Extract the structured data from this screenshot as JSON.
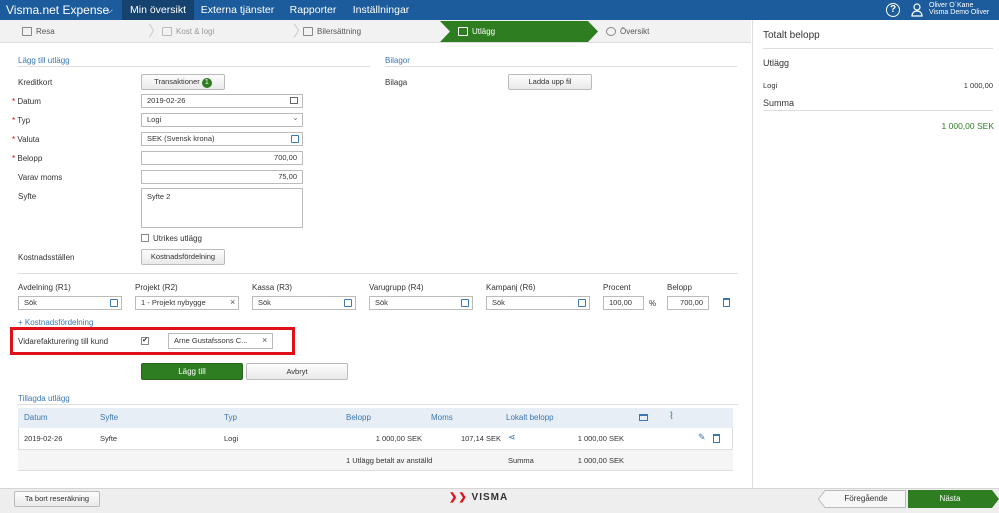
{
  "nav": {
    "app_title": "Visma.net Expense",
    "items": [
      "Min översikt",
      "Externa tjänster",
      "Rapporter",
      "Inställningar"
    ],
    "user_name": "Oliver O´Kane",
    "user_org": "Visma Demo Oliver",
    "help": "?"
  },
  "wizard": {
    "steps": [
      "Resa",
      "Kost & logi",
      "Bilersättning",
      "Utlägg",
      "Översikt"
    ]
  },
  "form": {
    "section_title": "Lägg till utlägg",
    "kreditkort_label": "Kreditkort",
    "transactions_btn": "Transaktioner",
    "transactions_count": "1",
    "datum_label": "Datum",
    "datum_value": "2019-02-26",
    "typ_label": "Typ",
    "typ_value": "Logi",
    "valuta_label": "Valuta",
    "valuta_value": "SEK (Svensk krona)",
    "belopp_label": "Belopp",
    "belopp_value": "700,00",
    "moms_label": "Varav moms",
    "moms_value": "75,00",
    "syfte_label": "Syfte",
    "syfte_value": "Syfte 2",
    "utrikes_label": "Utrikes utlägg",
    "kst_label": "Kostnadsställen",
    "kst_btn": "Kostnadsfördelning",
    "req": "*"
  },
  "bilagor": {
    "title": "Bilagor",
    "label": "Bilaga",
    "upload_btn": "Ladda upp fil"
  },
  "dims": {
    "labels": [
      "Avdelning (R1)",
      "Projekt (R2)",
      "Kassa (R3)",
      "Varugrupp (R4)",
      "Kampanj (R6)",
      "Procent",
      "Belopp"
    ],
    "values": [
      "Sök",
      "1 - Projekt nybygge",
      "Sök",
      "Sök",
      "Sök",
      "100,00",
      "700,00"
    ],
    "percent_sign": "%",
    "add_link": "+ Kostnadsfördelning"
  },
  "vidare": {
    "label": "Vidarefakturering till kund",
    "customer": "Arne Gustafssons C...",
    "clear": "×"
  },
  "actions": {
    "add": "Lägg till",
    "cancel": "Avbryt"
  },
  "added": {
    "title": "Tillagda utlägg",
    "headers": [
      "Datum",
      "Syfte",
      "Typ",
      "Belopp",
      "Moms",
      "Lokalt belopp"
    ],
    "row": {
      "datum": "2019-02-26",
      "syfte": "Syfte",
      "typ": "Logi",
      "belopp": "1 000,00 SEK",
      "moms": "107,14 SEK",
      "lokalt": "1 000,00 SEK"
    },
    "footer": {
      "count": "1 Utlägg betalt av anställd",
      "summa_label": "Summa",
      "summa_value": "1 000,00 SEK"
    }
  },
  "right": {
    "title": "Totalt belopp",
    "utlagg": "Utlägg",
    "logi_label": "Logi",
    "logi_value": "1 000,00",
    "summa": "Summa",
    "total": "1 000,00 SEK"
  },
  "bottom": {
    "delete_btn": "Ta bort reseräkning",
    "brand": "VISMA",
    "prev": "Föregående",
    "next": "Nästa"
  },
  "colors": {
    "nav": "#1d5c9c",
    "green": "#2e7d21",
    "link": "#3a78b5",
    "highlight": "#e0101a"
  }
}
